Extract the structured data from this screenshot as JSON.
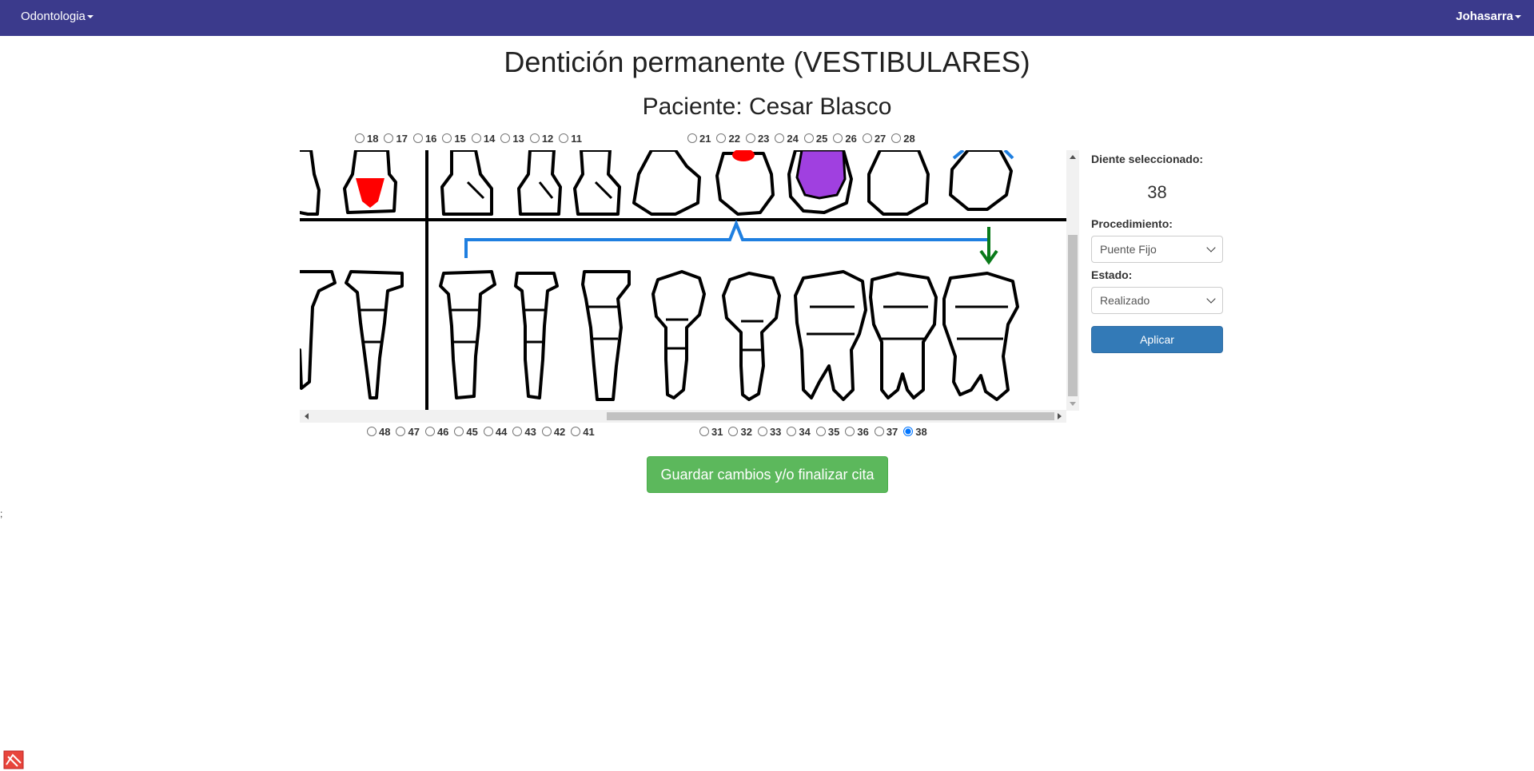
{
  "nav": {
    "brand": "Odontologia",
    "user": "Johasarra"
  },
  "page": {
    "title": "Dentición permanente (VESTIBULARES)",
    "patient_label": "Paciente: Cesar Blasco"
  },
  "teeth_top_left": [
    "18",
    "17",
    "16",
    "15",
    "14",
    "13",
    "12",
    "11"
  ],
  "teeth_top_right": [
    "21",
    "22",
    "23",
    "24",
    "25",
    "26",
    "27",
    "28"
  ],
  "teeth_bottom_left": [
    "48",
    "47",
    "46",
    "45",
    "44",
    "43",
    "42",
    "41"
  ],
  "teeth_bottom_right": [
    "31",
    "32",
    "33",
    "34",
    "35",
    "36",
    "37",
    "38"
  ],
  "selected_tooth": "38",
  "side_panel": {
    "selected_label": "Diente seleccionado:",
    "selected_value": "38",
    "procedure_label": "Procedimiento:",
    "procedure_value": "Puente Fijo",
    "status_label": "Estado:",
    "status_value": "Realizado",
    "apply_label": "Aplicar"
  },
  "save_button": "Guardar cambios y/o finalizar cita",
  "stray_text": ";",
  "colors": {
    "navbar": "#3b3a8c",
    "caries_red": "#ff0000",
    "purple_fill": "#a040e0",
    "bridge_blue": "#1f7fe0",
    "arrow_green": "#0a7a1a",
    "primary": "#337ab7",
    "success": "#5cb85c"
  }
}
